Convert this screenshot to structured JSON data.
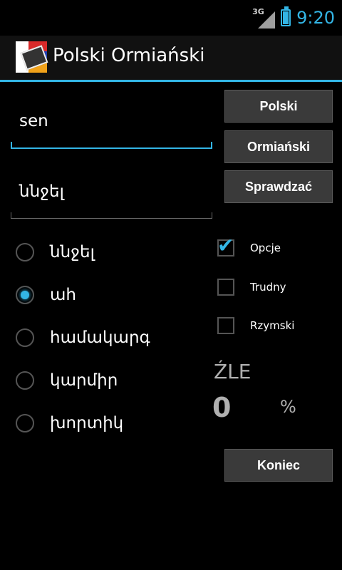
{
  "status": {
    "network": "3G",
    "time": "9:20",
    "icons": [
      "signal-icon",
      "battery-charging-icon"
    ]
  },
  "app": {
    "title": "Polski Ormiański"
  },
  "inputs": {
    "source": "sen",
    "answer": "ննջել"
  },
  "buttons": {
    "polish": "Polski",
    "armenian": "Ormiański",
    "check": "Sprawdzać",
    "end": "Koniec"
  },
  "choices": [
    {
      "label": "ննջել",
      "selected": false
    },
    {
      "label": "ահ",
      "selected": true
    },
    {
      "label": "համակարգ",
      "selected": false
    },
    {
      "label": "կարմիր",
      "selected": false
    },
    {
      "label": "խորտիկ",
      "selected": false
    }
  ],
  "options": [
    {
      "label": "Opcje",
      "checked": true
    },
    {
      "label": "Trudny",
      "checked": false
    },
    {
      "label": "Rzymski",
      "checked": false
    }
  ],
  "result": {
    "status": "ŹLE",
    "score": "0",
    "percent_sign": "%"
  },
  "colors": {
    "accent": "#33b5e5",
    "background": "#000000"
  }
}
